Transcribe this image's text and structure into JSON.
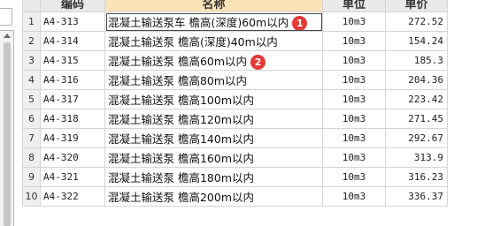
{
  "columns": {
    "code": "编码",
    "name": "名称",
    "unit": "单位",
    "price": "单价"
  },
  "rows": [
    {
      "idx": "1",
      "code": "A4-313",
      "name": "混凝土输送泵车 檐高(深度)60m以内",
      "unit": "10m3",
      "price": "272.52",
      "badge": "1"
    },
    {
      "idx": "2",
      "code": "A4-314",
      "name": "混凝土输送泵 檐高(深度)40m以内",
      "unit": "10m3",
      "price": "154.24",
      "badge": ""
    },
    {
      "idx": "3",
      "code": "A4-315",
      "name": "混凝土输送泵 檐高60m以内",
      "unit": "10m3",
      "price": "185.3",
      "badge": "2"
    },
    {
      "idx": "4",
      "code": "A4-316",
      "name": "混凝土输送泵 檐高80m以内",
      "unit": "10m3",
      "price": "204.36",
      "badge": ""
    },
    {
      "idx": "5",
      "code": "A4-317",
      "name": "混凝土输送泵 檐高100m以内",
      "unit": "10m3",
      "price": "223.42",
      "badge": ""
    },
    {
      "idx": "6",
      "code": "A4-318",
      "name": "混凝土输送泵 檐高120m以内",
      "unit": "10m3",
      "price": "271.45",
      "badge": ""
    },
    {
      "idx": "7",
      "code": "A4-319",
      "name": "混凝土输送泵 檐高140m以内",
      "unit": "10m3",
      "price": "292.67",
      "badge": ""
    },
    {
      "idx": "8",
      "code": "A4-320",
      "name": "混凝土输送泵 檐高160m以内",
      "unit": "10m3",
      "price": "313.9",
      "badge": ""
    },
    {
      "idx": "9",
      "code": "A4-321",
      "name": "混凝土输送泵 檐高180m以内",
      "unit": "10m3",
      "price": "316.23",
      "badge": ""
    },
    {
      "idx": "10",
      "code": "A4-322",
      "name": "混凝土输送泵 檐高200m以内",
      "unit": "10m3",
      "price": "336.37",
      "badge": ""
    }
  ],
  "badge_color": "#e53935",
  "header_highlight_color": "#fbe3b8"
}
